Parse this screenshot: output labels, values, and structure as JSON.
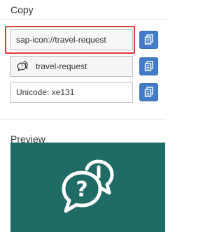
{
  "copy_section": {
    "title": "Copy",
    "rows": [
      {
        "label": "sap-icon://travel-request"
      },
      {
        "label": "travel-request",
        "icon": "travel-request-icon"
      },
      {
        "label": "Unicode: xe131"
      }
    ],
    "copy_button_icon": "copy-icon"
  },
  "preview_section": {
    "title": "Preview",
    "icon": "travel-request-icon"
  },
  "colors": {
    "accent_button": "#427cc9",
    "selection_border": "#e03a3a",
    "preview_background": "#1f6b66",
    "preview_icon": "#ffffff"
  }
}
